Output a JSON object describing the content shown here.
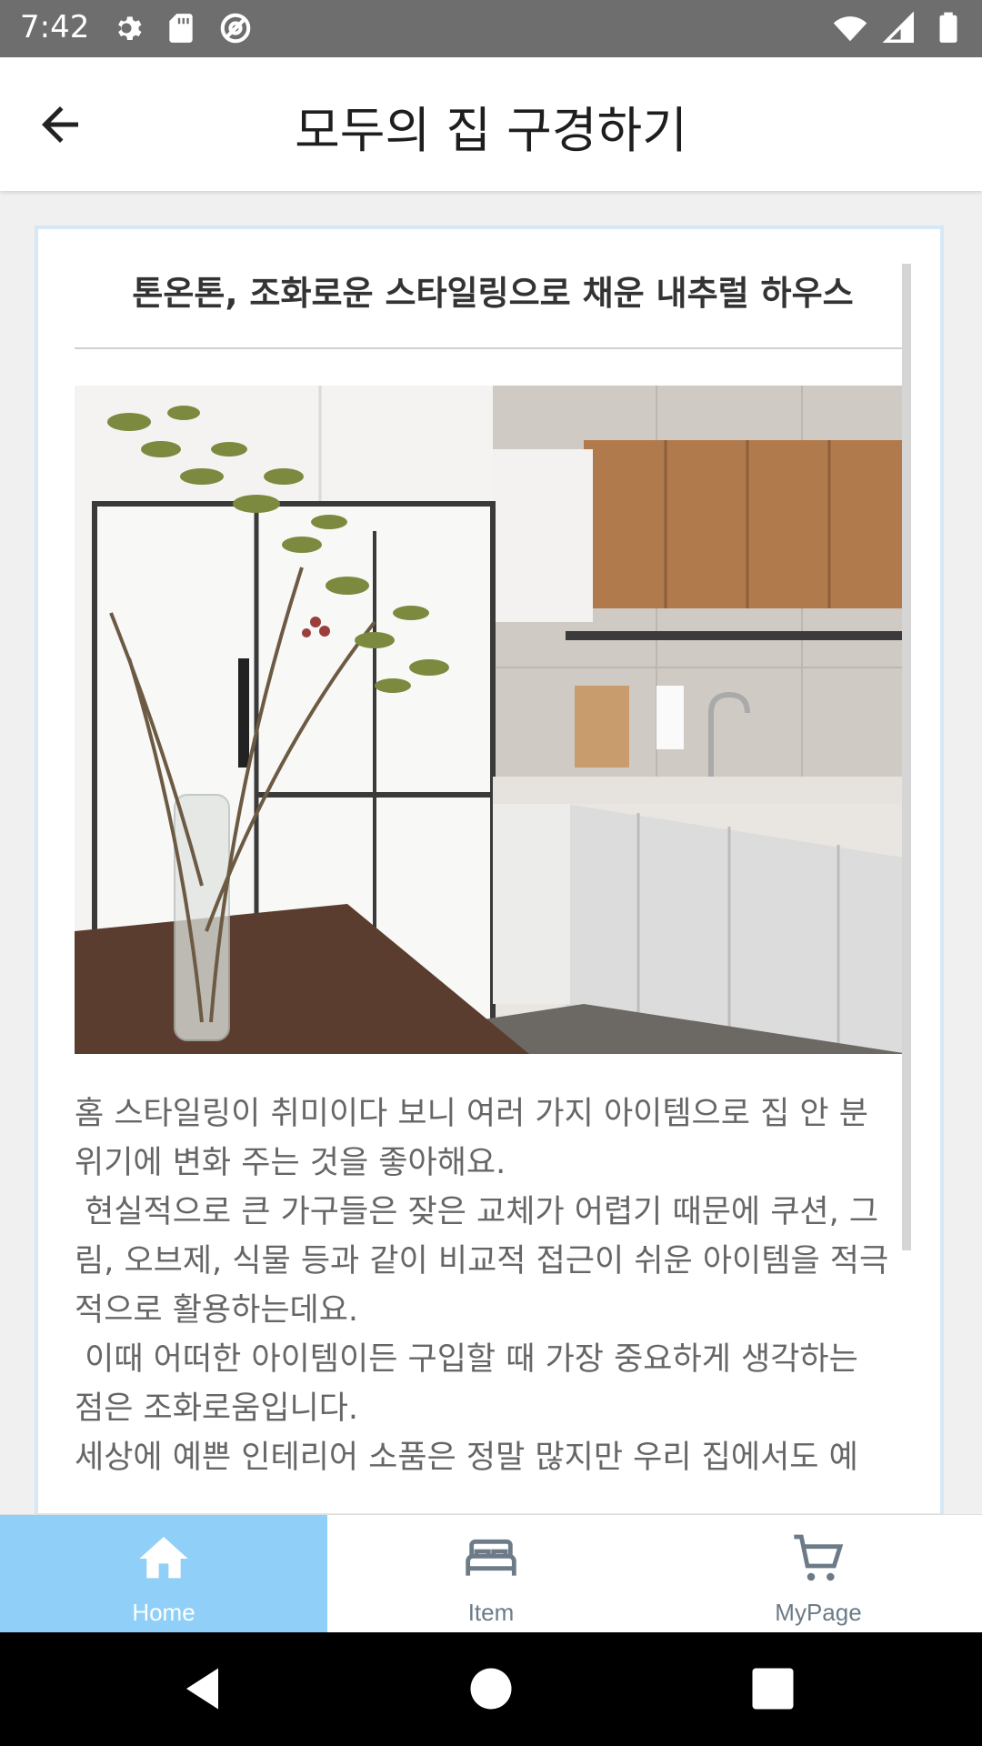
{
  "status_bar": {
    "time": "7:42"
  },
  "app_bar": {
    "title": "모두의 집 구경하기"
  },
  "post": {
    "title": "톤온톤, 조화로운 스타일링으로 채운 내추럴 하우스",
    "body": "홈 스타일링이 취미이다 보니 여러 가지 아이템으로 집 안 분\n위기에 변화 주는 것을 좋아해요.\n 현실적으로 큰 가구들은 잦은 교체가 어렵기 때문에 쿠션, 그\n림, 오브제, 식물 등과 같이 비교적 접근이 쉬운 아이템을 적극\n적으로 활용하는데요.\n 이때 어떠한 아이템이든 구입할 때 가장 중요하게 생각하는\n점은 조화로움입니다.\n세상에 예쁜 인테리어 소품은 정말 많지만 우리 집에서도 예"
  },
  "bottom_nav": {
    "items": [
      {
        "label": "Home",
        "icon": "home-icon",
        "active": true
      },
      {
        "label": "Item",
        "icon": "bed-icon",
        "active": false
      },
      {
        "label": "MyPage",
        "icon": "cart-icon",
        "active": false
      }
    ]
  },
  "colors": {
    "status_bar": "#6e6e6e",
    "active_tab": "#8fcff8",
    "inactive_tab_text": "#6c7b87",
    "card_border": "#d6e8f5"
  }
}
